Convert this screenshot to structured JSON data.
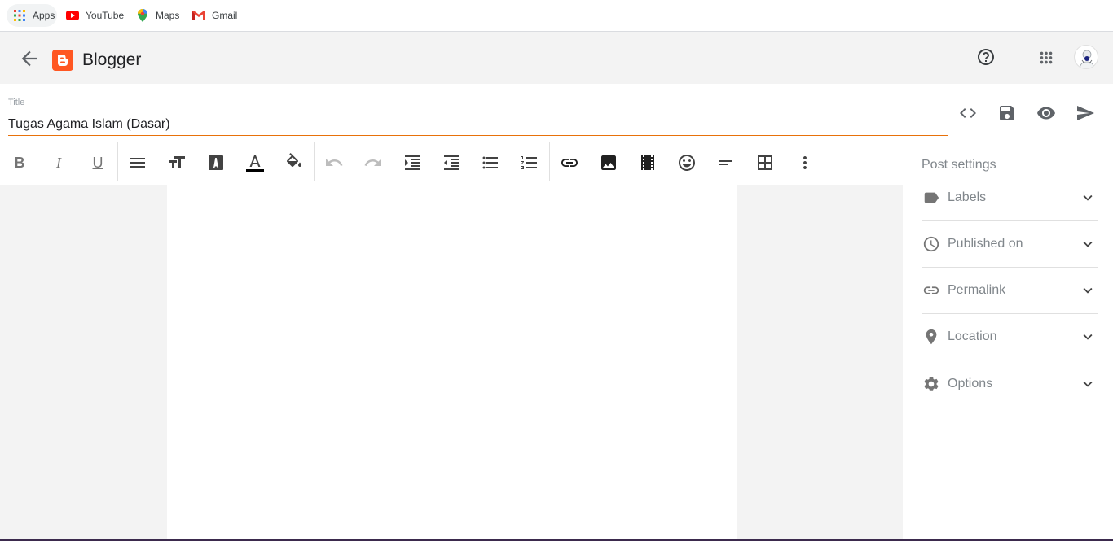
{
  "bookmarks": [
    {
      "label": "Apps",
      "icon": "apps-grid-icon"
    },
    {
      "label": "YouTube",
      "icon": "youtube-icon"
    },
    {
      "label": "Maps",
      "icon": "maps-pin-icon"
    },
    {
      "label": "Gmail",
      "icon": "gmail-icon"
    }
  ],
  "header": {
    "brand": "Blogger",
    "brand_color": "#ff5722"
  },
  "post": {
    "title_label": "Title",
    "title_value": "Tugas Agama Islam (Dasar)"
  },
  "accent_color": "#e8710a",
  "sidebar": {
    "title": "Post settings",
    "items": [
      {
        "label": "Labels",
        "icon": "label-tag-icon"
      },
      {
        "label": "Published on",
        "icon": "clock-icon"
      },
      {
        "label": "Permalink",
        "icon": "link-icon"
      },
      {
        "label": "Location",
        "icon": "location-pin-icon"
      },
      {
        "label": "Options",
        "icon": "gear-icon"
      }
    ]
  },
  "toolbar": {
    "bold": "B",
    "italic": "I",
    "underline": "U"
  }
}
